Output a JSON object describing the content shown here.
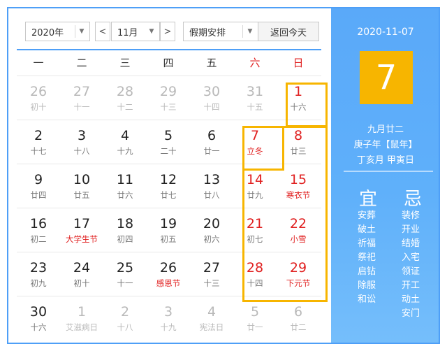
{
  "toolbar": {
    "year": "2020年",
    "prev": "<",
    "month": "11月",
    "next": ">",
    "holiday": "假期安排",
    "today": "返回今天",
    "dropdown_arrow": "▼"
  },
  "weekdays": [
    "一",
    "二",
    "三",
    "四",
    "五",
    "六",
    "日"
  ],
  "weeks": [
    [
      {
        "day": "26",
        "sub": "初十",
        "other": true
      },
      {
        "day": "27",
        "sub": "十一",
        "other": true
      },
      {
        "day": "28",
        "sub": "十二",
        "other": true
      },
      {
        "day": "29",
        "sub": "十三",
        "other": true
      },
      {
        "day": "30",
        "sub": "十四",
        "other": true
      },
      {
        "day": "31",
        "sub": "十五",
        "other": true
      },
      {
        "day": "1",
        "sub": "十六"
      }
    ],
    [
      {
        "day": "2",
        "sub": "十七"
      },
      {
        "day": "3",
        "sub": "十八"
      },
      {
        "day": "4",
        "sub": "十九"
      },
      {
        "day": "5",
        "sub": "二十"
      },
      {
        "day": "6",
        "sub": "廿一"
      },
      {
        "day": "7",
        "sub": "立冬",
        "sub_red": true
      },
      {
        "day": "8",
        "sub": "廿三"
      }
    ],
    [
      {
        "day": "9",
        "sub": "廿四"
      },
      {
        "day": "10",
        "sub": "廿五"
      },
      {
        "day": "11",
        "sub": "廿六"
      },
      {
        "day": "12",
        "sub": "廿七"
      },
      {
        "day": "13",
        "sub": "廿八"
      },
      {
        "day": "14",
        "sub": "廿九"
      },
      {
        "day": "15",
        "sub": "寒衣节",
        "sub_red": true
      }
    ],
    [
      {
        "day": "16",
        "sub": "初二"
      },
      {
        "day": "17",
        "sub": "大学生节",
        "sub_red": true
      },
      {
        "day": "18",
        "sub": "初四"
      },
      {
        "day": "19",
        "sub": "初五"
      },
      {
        "day": "20",
        "sub": "初六"
      },
      {
        "day": "21",
        "sub": "初七"
      },
      {
        "day": "22",
        "sub": "小雪",
        "sub_red": true
      }
    ],
    [
      {
        "day": "23",
        "sub": "初九"
      },
      {
        "day": "24",
        "sub": "初十"
      },
      {
        "day": "25",
        "sub": "十一"
      },
      {
        "day": "26",
        "sub": "感恩节",
        "sub_red": true
      },
      {
        "day": "27",
        "sub": "十三"
      },
      {
        "day": "28",
        "sub": "十四"
      },
      {
        "day": "29",
        "sub": "下元节",
        "sub_red": true
      }
    ],
    [
      {
        "day": "30",
        "sub": "十六"
      },
      {
        "day": "1",
        "sub": "艾滋病日",
        "other": true
      },
      {
        "day": "2",
        "sub": "十八",
        "other": true
      },
      {
        "day": "3",
        "sub": "十九",
        "other": true
      },
      {
        "day": "4",
        "sub": "宪法日",
        "other": true
      },
      {
        "day": "5",
        "sub": "廿一",
        "other": true
      },
      {
        "day": "6",
        "sub": "廿二",
        "other": true
      }
    ]
  ],
  "side": {
    "date": "2020-11-07",
    "day": "7",
    "lunar_date": "九月廿二",
    "year_gz": "庚子年【鼠年】",
    "month_day_gz": "丁亥月 甲寅日",
    "yi_label": "宜",
    "ji_label": "忌",
    "yi": [
      "安葬",
      "破土",
      "祈福",
      "祭祀",
      "启钻",
      "除服",
      "和讼"
    ],
    "ji": [
      "装修",
      "开业",
      "结婚",
      "入宅",
      "领证",
      "开工",
      "动土",
      "安门"
    ]
  },
  "colors": {
    "accent_blue": "#4e9ff7",
    "highlight_yellow": "#f7b500",
    "weekend_red": "#e02020"
  }
}
